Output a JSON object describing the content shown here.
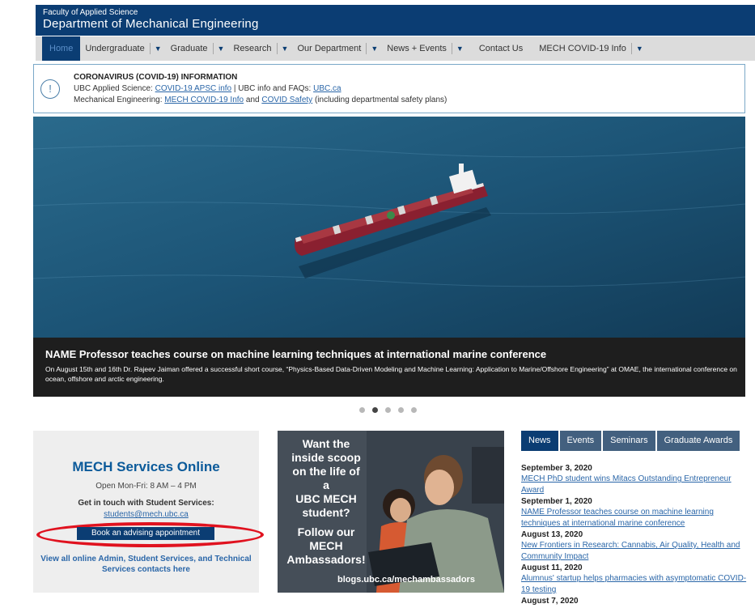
{
  "header": {
    "faculty": "Faculty of Applied Science",
    "department": "Department of Mechanical Engineering"
  },
  "nav": {
    "home": "Home",
    "items": [
      "Undergraduate",
      "Graduate",
      "Research",
      "Our Department",
      "News + Events",
      "Contact Us",
      "MECH COVID-19 Info"
    ]
  },
  "alert": {
    "icon": "!",
    "title": "CORONAVIRUS (COVID-19) INFORMATION",
    "line1_prefix": "UBC Applied Science: ",
    "line1_link1": "COVID-19 APSC info",
    "line1_mid": " | UBC info and FAQs: ",
    "line1_link2": "UBC.ca",
    "line2_prefix": "Mechanical Engineering: ",
    "line2_link1": "MECH COVID-19 Info",
    "line2_mid": " and ",
    "line2_link2": "COVID Safety",
    "line2_suffix": " (including departmental safety plans)"
  },
  "hero": {
    "headline": "NAME Professor teaches course on machine learning techniques at international marine conference",
    "body": "On August 15th and 16th Dr. Rajeev Jaiman offered a successful short course, “Physics-Based Data-Driven Modeling and Machine Learning: Application to Marine/Offshore Engineering” at OMAE, the international conference on ocean, offshore and arctic engineering.",
    "slide_count": 5,
    "active_slide": 2
  },
  "services": {
    "title": "MECH Services Online",
    "hours": "Open Mon-Fri: 8 AM – 4 PM",
    "touch": "Get in touch with Student Services:",
    "email": "students@mech.ubc.ca",
    "book_button": "Book an advising appointment",
    "contacts": "View all online Admin, Student Services, and Technical Services contacts here"
  },
  "ambassadors": {
    "line1": "Want the",
    "line2": "inside scoop",
    "line3": "on the life of a",
    "line4": "UBC MECH",
    "line5": "student?",
    "follow1": "Follow our",
    "follow2": "MECH",
    "follow3": "Ambassadors!",
    "url": "blogs.ubc.ca/mechambassadors"
  },
  "tabs": [
    "News",
    "Events",
    "Seminars",
    "Graduate Awards"
  ],
  "news": [
    {
      "date": "September 3, 2020",
      "title": "MECH PhD student wins Mitacs Outstanding Entrepreneur Award"
    },
    {
      "date": "September 1, 2020",
      "title": "NAME Professor teaches course on machine learning techniques at international marine conference"
    },
    {
      "date": "August 13, 2020",
      "title": "New Frontiers in Research: Cannabis, Air Quality, Health and Community Impact"
    },
    {
      "date": "August 11, 2020",
      "title": "Alumnus' startup helps pharmacies with asymptomatic COVID-19 testing"
    },
    {
      "date": "August 7, 2020",
      "title": ""
    }
  ],
  "colors": {
    "brand": "#0b3d73",
    "link": "#2a66a8",
    "highlight_oval": "#e0121f"
  }
}
